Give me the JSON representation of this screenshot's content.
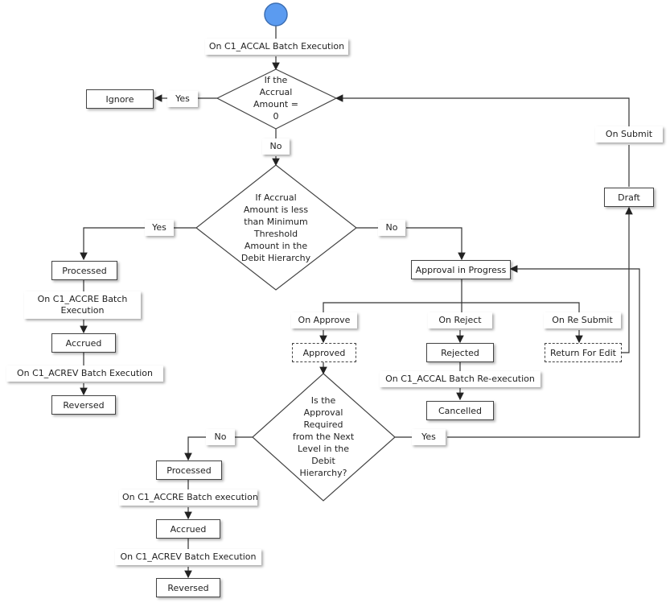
{
  "start_event": {
    "label": "On C1_ACCAL Batch Execution",
    "color": "#5b9bf0"
  },
  "decision1": {
    "text": "If the\nAccrual\nAmount =\n0",
    "yes_label": "Yes",
    "no_label": "No",
    "yes_target": "Ignore"
  },
  "decision2": {
    "text": "If Accrual\nAmount  is less\nthan Minimum\nThreshold\nAmount  in the\nDebit Hierarchy",
    "yes_label": "Yes",
    "no_label": "No"
  },
  "left_branch": {
    "processed": "Processed",
    "accre_event": "On C1_ACCRE Batch\nExecution",
    "accrued": "Accrued",
    "acrev_event": "On C1_ACREV Batch Execution",
    "reversed": "Reversed"
  },
  "approval": {
    "status": "Approval  in Progress",
    "on_approve": "On Approve",
    "approved": "Approved",
    "on_reject": "On Reject",
    "rejected": "Rejected",
    "reexec_event": "On C1_ACCAL Batch Re-execution",
    "cancelled": "Cancelled",
    "on_resubmit": "On Re Submit",
    "return_for_edit": "Return For  Edit"
  },
  "draft": {
    "status": "Draft",
    "on_submit": "On Submit"
  },
  "decision3": {
    "text": "Is the\nApproval\nRequired\nfrom the Next\nLevel in the\nDebit\nHierarchy?",
    "yes_label": "Yes",
    "no_label": "No"
  },
  "bottom_branch": {
    "processed": "Processed",
    "accre_event": "On C1_ACCRE Batch execution",
    "accrued": "Accrued",
    "acrev_event": "On C1_ACREV Batch Execution",
    "reversed": "Reversed"
  }
}
